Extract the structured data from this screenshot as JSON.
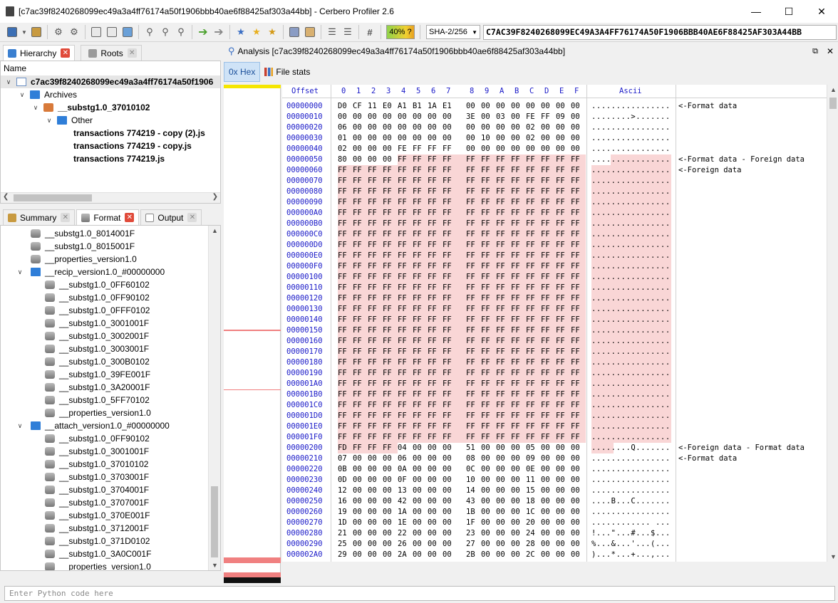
{
  "window": {
    "title": "[c7ac39f8240268099ec49a3a4ff76174a50f1906bbb40ae6f88425af303a44bb] - Cerbero Profiler 2.6"
  },
  "toolbar": {
    "entropy_label": "40% ?",
    "hash_algorithm": "SHA-2/256",
    "hash_value": "C7AC39F8240268099EC49A3A4FF76174A50F1906BBB40AE6F88425AF303A44BB"
  },
  "left_top": {
    "tabs": [
      "Hierarchy",
      "Roots"
    ],
    "column_header": "Name",
    "tree": [
      {
        "label": "c7ac39f8240268099ec49a3a4ff76174a50f1906",
        "level": 0,
        "icon": "file-icon",
        "bold": true,
        "expanded": true,
        "selected": true
      },
      {
        "label": "Archives",
        "level": 1,
        "icon": "folder-icon",
        "bold": false,
        "expanded": true
      },
      {
        "label": "__substg1.0_37010102",
        "level": 2,
        "icon": "archive-icon",
        "bold": true,
        "expanded": true
      },
      {
        "label": "Other",
        "level": 3,
        "icon": "folder-icon",
        "bold": false,
        "expanded": true
      },
      {
        "label": "transactions 774219 - copy (2).js",
        "level": 4,
        "icon": "",
        "bold": true
      },
      {
        "label": "transactions 774219 - copy.js",
        "level": 4,
        "icon": "",
        "bold": true
      },
      {
        "label": "transactions 774219.js",
        "level": 4,
        "icon": "",
        "bold": true
      }
    ]
  },
  "left_bottom": {
    "tabs": [
      "Summary",
      "Format",
      "Output"
    ],
    "tree": [
      {
        "label": "__substg1.0_8014001F",
        "level": 1,
        "icon": "stream-icon"
      },
      {
        "label": "__substg1.0_8015001F",
        "level": 1,
        "icon": "stream-icon"
      },
      {
        "label": "__properties_version1.0",
        "level": 1,
        "icon": "stream-icon"
      },
      {
        "label": "__recip_version1.0_#00000000",
        "level": 1,
        "icon": "folder-icon",
        "expanded": true
      },
      {
        "label": "__substg1.0_0FF60102",
        "level": 2,
        "icon": "stream-icon"
      },
      {
        "label": "__substg1.0_0FF90102",
        "level": 2,
        "icon": "stream-icon"
      },
      {
        "label": "__substg1.0_0FFF0102",
        "level": 2,
        "icon": "stream-icon"
      },
      {
        "label": "__substg1.0_3001001F",
        "level": 2,
        "icon": "stream-icon"
      },
      {
        "label": "__substg1.0_3002001F",
        "level": 2,
        "icon": "stream-icon"
      },
      {
        "label": "__substg1.0_3003001F",
        "level": 2,
        "icon": "stream-icon"
      },
      {
        "label": "__substg1.0_300B0102",
        "level": 2,
        "icon": "stream-icon"
      },
      {
        "label": "__substg1.0_39FE001F",
        "level": 2,
        "icon": "stream-icon"
      },
      {
        "label": "__substg1.0_3A20001F",
        "level": 2,
        "icon": "stream-icon"
      },
      {
        "label": "__substg1.0_5FF70102",
        "level": 2,
        "icon": "stream-icon"
      },
      {
        "label": "__properties_version1.0",
        "level": 2,
        "icon": "stream-icon"
      },
      {
        "label": "__attach_version1.0_#00000000",
        "level": 1,
        "icon": "folder-icon",
        "expanded": true
      },
      {
        "label": "__substg1.0_0FF90102",
        "level": 2,
        "icon": "stream-icon"
      },
      {
        "label": "__substg1.0_3001001F",
        "level": 2,
        "icon": "stream-icon"
      },
      {
        "label": "__substg1.0_37010102",
        "level": 2,
        "icon": "stream-icon"
      },
      {
        "label": "__substg1.0_3703001F",
        "level": 2,
        "icon": "stream-icon"
      },
      {
        "label": "__substg1.0_3704001F",
        "level": 2,
        "icon": "stream-icon"
      },
      {
        "label": "__substg1.0_3707001F",
        "level": 2,
        "icon": "stream-icon"
      },
      {
        "label": "__substg1.0_370E001F",
        "level": 2,
        "icon": "stream-icon"
      },
      {
        "label": "__substg1.0_3712001F",
        "level": 2,
        "icon": "stream-icon"
      },
      {
        "label": "__substg1.0_371D0102",
        "level": 2,
        "icon": "stream-icon"
      },
      {
        "label": "__substg1.0_3A0C001F",
        "level": 2,
        "icon": "stream-icon"
      },
      {
        "label": "__properties_version1.0",
        "level": 2,
        "icon": "stream-icon"
      }
    ]
  },
  "analysis": {
    "title": "Analysis [c7ac39f8240268099ec49a3a4ff76174a50f1906bbb40ae6f88425af303a44bb]",
    "view_tabs": [
      "0x Hex",
      "File stats"
    ]
  },
  "hex": {
    "header": {
      "offset": "Offset",
      "cols": [
        "0",
        "1",
        "2",
        "3",
        "4",
        "5",
        "6",
        "7",
        "8",
        "9",
        "A",
        "B",
        "C",
        "D",
        "E",
        "F"
      ],
      "ascii": "Ascii"
    },
    "rows": [
      {
        "offset": "00000000",
        "bytes": "D0 CF 11 E0 A1 B1 1A E1 00 00 00 00 00 00 00 00",
        "ascii": "................",
        "note": "<-Format data",
        "hl_from": 16
      },
      {
        "offset": "00000010",
        "bytes": "00 00 00 00 00 00 00 00 3E 00 03 00 FE FF 09 00",
        "ascii": "........>.......",
        "note": "",
        "hl_from": 16
      },
      {
        "offset": "00000020",
        "bytes": "06 00 00 00 00 00 00 00 00 00 00 00 02 00 00 00",
        "ascii": "................",
        "note": "",
        "hl_from": 16
      },
      {
        "offset": "00000030",
        "bytes": "01 00 00 00 00 00 00 00 00 10 00 00 02 00 00 00",
        "ascii": "................",
        "note": "",
        "hl_from": 16
      },
      {
        "offset": "00000040",
        "bytes": "02 00 00 00 FE FF FF FF 00 00 00 00 00 00 00 00",
        "ascii": "................",
        "note": "",
        "hl_from": 16
      },
      {
        "offset": "00000050",
        "bytes": "80 00 00 00 FF FF FF FF FF FF FF FF FF FF FF FF",
        "ascii": "................",
        "note": "<-Format data - Foreign data",
        "hl_from": 4
      },
      {
        "offset": "00000060",
        "bytes": "FF FF FF FF FF FF FF FF FF FF FF FF FF FF FF FF",
        "ascii": "................",
        "note": "<-Foreign data",
        "hl_from": 0
      },
      {
        "offset": "00000070",
        "bytes": "FF FF FF FF FF FF FF FF FF FF FF FF FF FF FF FF",
        "ascii": "................",
        "note": "",
        "hl_from": 0
      },
      {
        "offset": "00000080",
        "bytes": "FF FF FF FF FF FF FF FF FF FF FF FF FF FF FF FF",
        "ascii": "................",
        "note": "",
        "hl_from": 0
      },
      {
        "offset": "00000090",
        "bytes": "FF FF FF FF FF FF FF FF FF FF FF FF FF FF FF FF",
        "ascii": "................",
        "note": "",
        "hl_from": 0
      },
      {
        "offset": "000000A0",
        "bytes": "FF FF FF FF FF FF FF FF FF FF FF FF FF FF FF FF",
        "ascii": "................",
        "note": "",
        "hl_from": 0
      },
      {
        "offset": "000000B0",
        "bytes": "FF FF FF FF FF FF FF FF FF FF FF FF FF FF FF FF",
        "ascii": "................",
        "note": "",
        "hl_from": 0
      },
      {
        "offset": "000000C0",
        "bytes": "FF FF FF FF FF FF FF FF FF FF FF FF FF FF FF FF",
        "ascii": "................",
        "note": "",
        "hl_from": 0
      },
      {
        "offset": "000000D0",
        "bytes": "FF FF FF FF FF FF FF FF FF FF FF FF FF FF FF FF",
        "ascii": "................",
        "note": "",
        "hl_from": 0
      },
      {
        "offset": "000000E0",
        "bytes": "FF FF FF FF FF FF FF FF FF FF FF FF FF FF FF FF",
        "ascii": "................",
        "note": "",
        "hl_from": 0
      },
      {
        "offset": "000000F0",
        "bytes": "FF FF FF FF FF FF FF FF FF FF FF FF FF FF FF FF",
        "ascii": "................",
        "note": "",
        "hl_from": 0
      },
      {
        "offset": "00000100",
        "bytes": "FF FF FF FF FF FF FF FF FF FF FF FF FF FF FF FF",
        "ascii": "................",
        "note": "",
        "hl_from": 0
      },
      {
        "offset": "00000110",
        "bytes": "FF FF FF FF FF FF FF FF FF FF FF FF FF FF FF FF",
        "ascii": "................",
        "note": "",
        "hl_from": 0
      },
      {
        "offset": "00000120",
        "bytes": "FF FF FF FF FF FF FF FF FF FF FF FF FF FF FF FF",
        "ascii": "................",
        "note": "",
        "hl_from": 0
      },
      {
        "offset": "00000130",
        "bytes": "FF FF FF FF FF FF FF FF FF FF FF FF FF FF FF FF",
        "ascii": "................",
        "note": "",
        "hl_from": 0
      },
      {
        "offset": "00000140",
        "bytes": "FF FF FF FF FF FF FF FF FF FF FF FF FF FF FF FF",
        "ascii": "................",
        "note": "",
        "hl_from": 0
      },
      {
        "offset": "00000150",
        "bytes": "FF FF FF FF FF FF FF FF FF FF FF FF FF FF FF FF",
        "ascii": "................",
        "note": "",
        "hl_from": 0
      },
      {
        "offset": "00000160",
        "bytes": "FF FF FF FF FF FF FF FF FF FF FF FF FF FF FF FF",
        "ascii": "................",
        "note": "",
        "hl_from": 0
      },
      {
        "offset": "00000170",
        "bytes": "FF FF FF FF FF FF FF FF FF FF FF FF FF FF FF FF",
        "ascii": "................",
        "note": "",
        "hl_from": 0
      },
      {
        "offset": "00000180",
        "bytes": "FF FF FF FF FF FF FF FF FF FF FF FF FF FF FF FF",
        "ascii": "................",
        "note": "",
        "hl_from": 0
      },
      {
        "offset": "00000190",
        "bytes": "FF FF FF FF FF FF FF FF FF FF FF FF FF FF FF FF",
        "ascii": "................",
        "note": "",
        "hl_from": 0
      },
      {
        "offset": "000001A0",
        "bytes": "FF FF FF FF FF FF FF FF FF FF FF FF FF FF FF FF",
        "ascii": "................",
        "note": "",
        "hl_from": 0
      },
      {
        "offset": "000001B0",
        "bytes": "FF FF FF FF FF FF FF FF FF FF FF FF FF FF FF FF",
        "ascii": "................",
        "note": "",
        "hl_from": 0
      },
      {
        "offset": "000001C0",
        "bytes": "FF FF FF FF FF FF FF FF FF FF FF FF FF FF FF FF",
        "ascii": "................",
        "note": "",
        "hl_from": 0
      },
      {
        "offset": "000001D0",
        "bytes": "FF FF FF FF FF FF FF FF FF FF FF FF FF FF FF FF",
        "ascii": "................",
        "note": "",
        "hl_from": 0
      },
      {
        "offset": "000001E0",
        "bytes": "FF FF FF FF FF FF FF FF FF FF FF FF FF FF FF FF",
        "ascii": "................",
        "note": "",
        "hl_from": 0
      },
      {
        "offset": "000001F0",
        "bytes": "FF FF FF FF FF FF FF FF FF FF FF FF FF FF FF FF",
        "ascii": "................",
        "note": "",
        "hl_from": 0
      },
      {
        "offset": "00000200",
        "bytes": "FD FF FF FF 04 00 00 00 51 00 00 00 05 00 00 00",
        "ascii": "........Q.......",
        "note": "<-Foreign data - Format data",
        "hl_from": 0,
        "hl_to": 4
      },
      {
        "offset": "00000210",
        "bytes": "07 00 00 00 06 00 00 00 08 00 00 00 09 00 00 00",
        "ascii": "................",
        "note": "<-Format data",
        "hl_from": 16
      },
      {
        "offset": "00000220",
        "bytes": "0B 00 00 00 0A 00 00 00 0C 00 00 00 0E 00 00 00",
        "ascii": "................",
        "note": "",
        "hl_from": 16
      },
      {
        "offset": "00000230",
        "bytes": "0D 00 00 00 0F 00 00 00 10 00 00 00 11 00 00 00",
        "ascii": "................",
        "note": "",
        "hl_from": 16
      },
      {
        "offset": "00000240",
        "bytes": "12 00 00 00 13 00 00 00 14 00 00 00 15 00 00 00",
        "ascii": "................",
        "note": "",
        "hl_from": 16
      },
      {
        "offset": "00000250",
        "bytes": "16 00 00 00 42 00 00 00 43 00 00 00 18 00 00 00",
        "ascii": "....B...C.......",
        "note": "",
        "hl_from": 16
      },
      {
        "offset": "00000260",
        "bytes": "19 00 00 00 1A 00 00 00 1B 00 00 00 1C 00 00 00",
        "ascii": "................",
        "note": "",
        "hl_from": 16
      },
      {
        "offset": "00000270",
        "bytes": "1D 00 00 00 1E 00 00 00 1F 00 00 00 20 00 00 00",
        "ascii": "............ ...",
        "note": "",
        "hl_from": 16
      },
      {
        "offset": "00000280",
        "bytes": "21 00 00 00 22 00 00 00 23 00 00 00 24 00 00 00",
        "ascii": "!...\"...#...$...",
        "note": "",
        "hl_from": 16
      },
      {
        "offset": "00000290",
        "bytes": "25 00 00 00 26 00 00 00 27 00 00 00 28 00 00 00",
        "ascii": "%...&...'...(...",
        "note": "",
        "hl_from": 16
      },
      {
        "offset": "000002A0",
        "bytes": "29 00 00 00 2A 00 00 00 2B 00 00 00 2C 00 00 00",
        "ascii": ")...*...+...,...",
        "note": "",
        "hl_from": 16
      }
    ]
  },
  "console": {
    "placeholder": "Enter Python code here"
  },
  "colors": {
    "highlight": "#f9d6d6",
    "offset_blue": "#1a1ac8",
    "strip_yellow": "#f5e600",
    "strip_red": "#f08080"
  }
}
